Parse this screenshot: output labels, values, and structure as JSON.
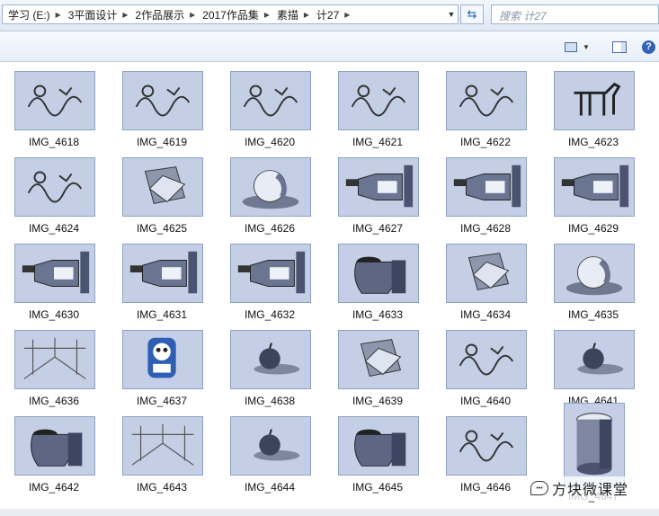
{
  "address": {
    "crumbs": [
      "学习 (E:)",
      "3平面设计",
      "2作品展示",
      "2017作品集",
      "素描",
      "计27"
    ]
  },
  "search": {
    "placeholder": "搜索 计27"
  },
  "toolbar": {
    "help_label": "?"
  },
  "files": [
    {
      "name": "IMG_4618",
      "subject": "doodle"
    },
    {
      "name": "IMG_4619",
      "subject": "doodle"
    },
    {
      "name": "IMG_4620",
      "subject": "doodle"
    },
    {
      "name": "IMG_4621",
      "subject": "doodle"
    },
    {
      "name": "IMG_4622",
      "subject": "doodle"
    },
    {
      "name": "IMG_4623",
      "subject": "horse"
    },
    {
      "name": "IMG_4624",
      "subject": "doodle"
    },
    {
      "name": "IMG_4625",
      "subject": "geometry"
    },
    {
      "name": "IMG_4626",
      "subject": "sphere"
    },
    {
      "name": "IMG_4627",
      "subject": "bottle"
    },
    {
      "name": "IMG_4628",
      "subject": "bottle"
    },
    {
      "name": "IMG_4629",
      "subject": "bottle"
    },
    {
      "name": "IMG_4630",
      "subject": "bottle"
    },
    {
      "name": "IMG_4631",
      "subject": "bottle"
    },
    {
      "name": "IMG_4632",
      "subject": "bottle"
    },
    {
      "name": "IMG_4633",
      "subject": "jar"
    },
    {
      "name": "IMG_4634",
      "subject": "geometry"
    },
    {
      "name": "IMG_4635",
      "subject": "sphere"
    },
    {
      "name": "IMG_4636",
      "subject": "perspective"
    },
    {
      "name": "IMG_4637",
      "subject": "cartoon"
    },
    {
      "name": "IMG_4638",
      "subject": "apple"
    },
    {
      "name": "IMG_4639",
      "subject": "geometry"
    },
    {
      "name": "IMG_4640",
      "subject": "doodle"
    },
    {
      "name": "IMG_4641",
      "subject": "apple"
    },
    {
      "name": "IMG_4642",
      "subject": "jar"
    },
    {
      "name": "IMG_4643",
      "subject": "perspective"
    },
    {
      "name": "IMG_4644",
      "subject": "apple"
    },
    {
      "name": "IMG_4645",
      "subject": "jar"
    },
    {
      "name": "IMG_4646",
      "subject": "doodle"
    },
    {
      "name": "IMG_4647",
      "subject": "cylinder",
      "portrait": true
    }
  ],
  "watermark": {
    "text": "方块微课堂"
  },
  "colors": {
    "accent": "#2f63b4",
    "thumb_bg": "#c4cfe6"
  }
}
